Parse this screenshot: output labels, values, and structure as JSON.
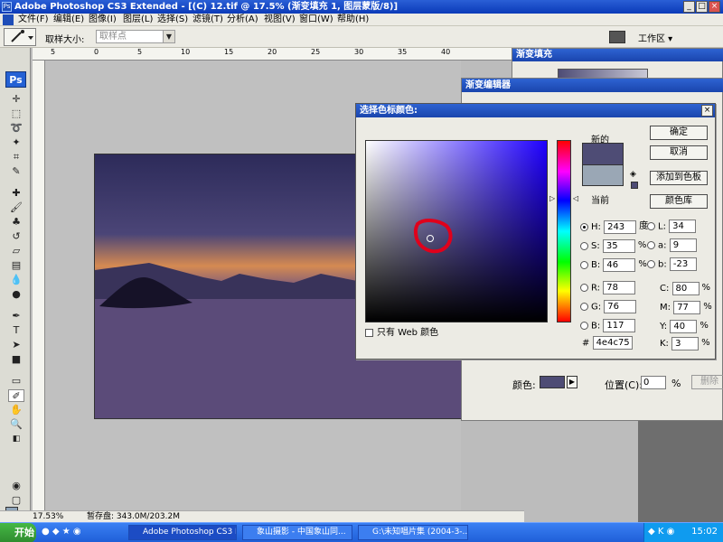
{
  "window": {
    "title": "Adobe Photoshop CS3 Extended - [(C) 12.tif @ 17.5% (渐变填充 1, 图层蒙版/8)]",
    "app_icon_text": "Ps",
    "min": "_",
    "max": "□",
    "close": "×"
  },
  "menu": [
    "文件(F)",
    "编辑(E)",
    "图像(I)",
    "图层(L)",
    "选择(S)",
    "滤镜(T)",
    "分析(A)",
    "视图(V)",
    "窗口(W)",
    "帮助(H)"
  ],
  "options": {
    "sample_size_label": "取样大小:",
    "sample_size_value": "取样点",
    "workspace": "工作区 ▾"
  },
  "ruler_top": [
    "5",
    "0",
    "5",
    "10",
    "15",
    "20",
    "25",
    "30",
    "35",
    "40"
  ],
  "toolbox": {
    "logo": "Ps"
  },
  "status": {
    "zoom": "17.53%",
    "doc": "暂存盘: 343.0M/203.2M"
  },
  "gradient_fill": {
    "title": "渐变填充"
  },
  "gradient_editor": {
    "title": "渐变编辑器",
    "color_label": "颜色:",
    "position_label": "位置(C):",
    "position_value": "0",
    "percent": "%",
    "delete_label": "删除"
  },
  "picker": {
    "title": "选择色标颜色:",
    "close": "×",
    "new_label": "新的",
    "current_label": "当前",
    "ok": "确定",
    "cancel": "取消",
    "add_to_swatches": "添加到色板",
    "color_libraries": "颜色库",
    "only_web": "只有 Web 颜色",
    "fields": {
      "H": "243",
      "H_unit": "度",
      "S": "35",
      "S_unit": "%",
      "B": "46",
      "B_unit": "%",
      "R": "78",
      "G": "76",
      "Bl": "117",
      "L": "34",
      "a": "9",
      "b": "-23",
      "C": "80",
      "M": "77",
      "Y": "40",
      "K": "3",
      "hex": "4e4c75"
    },
    "colors": {
      "new": "#4e4c75",
      "current": "#9aa7b5",
      "hue": "#1f00ff",
      "marker": "#e0001b"
    }
  },
  "taskbar": {
    "start": "开始",
    "tasks": [
      "Adobe Photoshop CS3 E...",
      "象山摄影 - 中国象山同...",
      "G:\\未知唱片集 (2004-3-..."
    ],
    "clock": "15:02"
  }
}
